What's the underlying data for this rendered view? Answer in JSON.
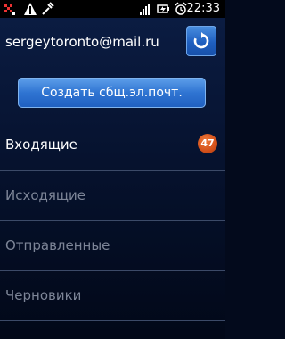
{
  "status_bar": {
    "time": "22:33",
    "left_icons": [
      "missed-call-icon",
      "warning-icon",
      "usb-debug-icon"
    ],
    "right_icons": [
      "signal-icon",
      "battery-icon",
      "alarm-icon"
    ]
  },
  "account": {
    "email": "sergeytoronto@mail.ru",
    "refresh_icon": "refresh-icon"
  },
  "compose": {
    "label": "Создать сбщ.эл.почт."
  },
  "folders": [
    {
      "label": "Входящие",
      "count": "47",
      "state": "active"
    },
    {
      "label": "Исходящие",
      "count": "",
      "state": "dim"
    },
    {
      "label": "Отправленные",
      "count": "",
      "state": "dim"
    },
    {
      "label": "Черновики",
      "count": "",
      "state": "dim"
    }
  ],
  "colors": {
    "background": "#030a1c",
    "accent_blue": "#2f74d2",
    "badge_orange": "#d2501a",
    "dim_text": "#7d8597"
  }
}
